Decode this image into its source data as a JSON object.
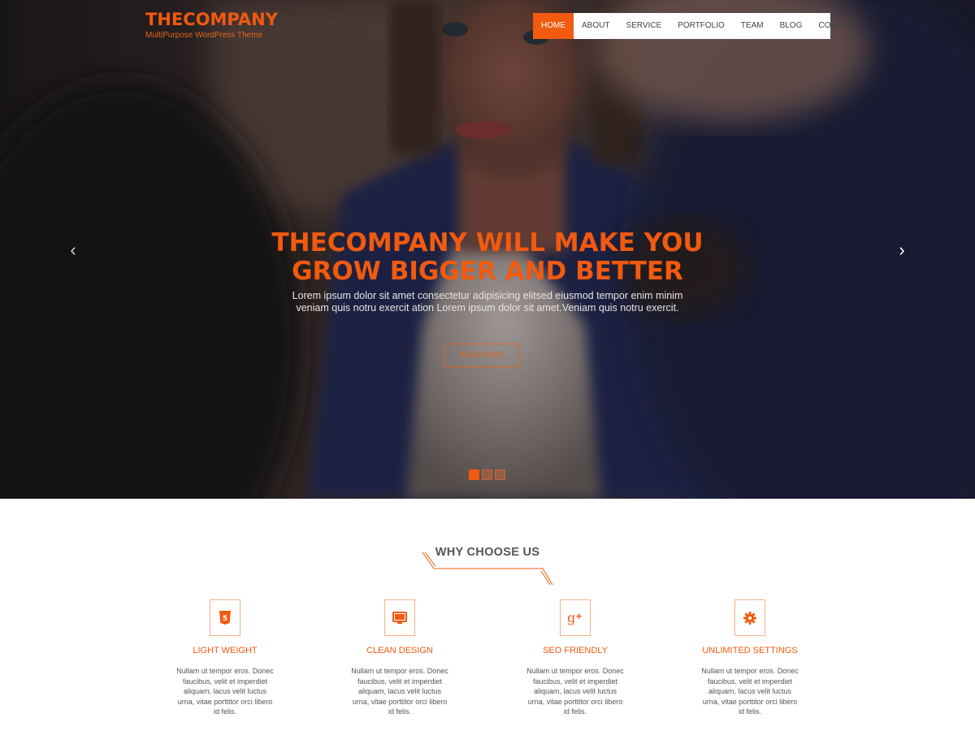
{
  "brand": {
    "name": "THECOMPANY",
    "tagline": "MultiPurpose WordPress Theme"
  },
  "nav": {
    "items": [
      {
        "label": "HOME",
        "active": true
      },
      {
        "label": "ABOUT"
      },
      {
        "label": "SERVICE"
      },
      {
        "label": "PORTFOLIO"
      },
      {
        "label": "TEAM"
      },
      {
        "label": "BLOG"
      },
      {
        "label": "CONTACT"
      }
    ]
  },
  "hero": {
    "title_line1": "THECOMPANY WILL MAKE YOU",
    "title_line2": "GROW BIGGER AND BETTER",
    "text": "Lorem ipsum dolor sit amet consectetur adipisicing elitsed eiusmod tempor enim minim veniam quis notru exercit ation Lorem ipsum dolor sit amet.Veniam quis notru exercit.",
    "button_label": "READ MORE",
    "prev_arrow": "‹",
    "next_arrow": "›",
    "slides": 3,
    "active_slide": 1
  },
  "why": {
    "title": "WHY CHOOSE US",
    "features": [
      {
        "icon": "html5-icon",
        "title": "LIGHT WEIGHT",
        "text": "Nullam ut tempor eros. Donec faucibus, velit et imperdiet aliquam, lacus velit luctus urna, vitae porttitor orci libero id felis."
      },
      {
        "icon": "monitor-icon",
        "title": "CLEAN DESIGN",
        "text": "Nullam ut tempor eros. Donec faucibus, velit et imperdiet aliquam, lacus velit luctus urna, vitae porttitor orci libero id felis."
      },
      {
        "icon": "google-plus-icon",
        "title": "SEO FRIENDLY",
        "text": "Nullam ut tempor eros. Donec faucibus, velit et imperdiet aliquam, lacus velit luctus urna, vitae porttitor orci libero id felis."
      },
      {
        "icon": "gear-icon",
        "title": "UNLIMITED SETTINGS",
        "text": "Nullam ut tempor eros. Donec faucibus, velit et imperdiet aliquam, lacus velit luctus urna, vitae porttitor orci libero id felis."
      }
    ]
  },
  "colors": {
    "accent": "#f15a0f",
    "text": "#555555"
  }
}
